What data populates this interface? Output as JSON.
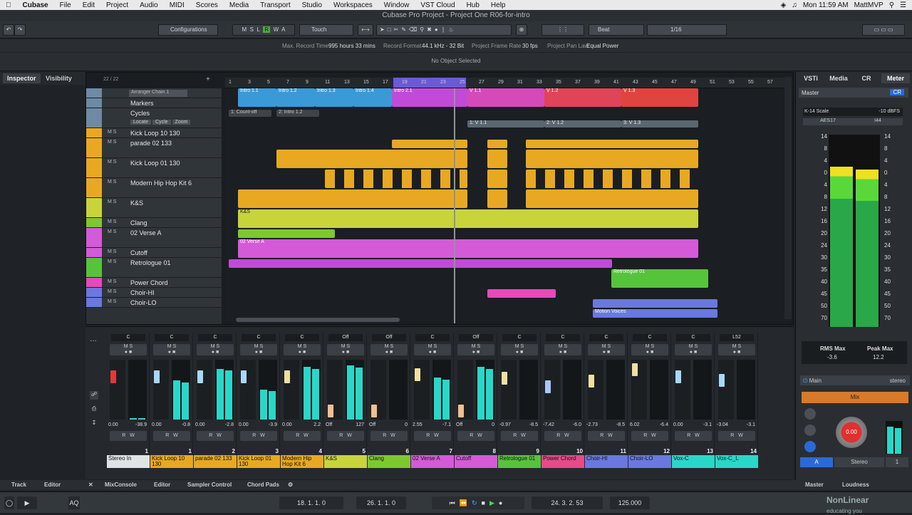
{
  "menubar": {
    "items": [
      "Cubase",
      "File",
      "Edit",
      "Project",
      "Audio",
      "MIDI",
      "Scores",
      "Media",
      "Transport",
      "Studio",
      "Workspaces",
      "Window",
      "VST Cloud",
      "Hub",
      "Help"
    ],
    "clock": "Mon 11:59 AM",
    "user": "MattMVP"
  },
  "window_title": "Cubase Pro Project - Project One R06-for-intro",
  "toolbar": {
    "configurations": "Configurations",
    "automation_mode": "Touch",
    "snap_type": "Beat",
    "quantize": "1/16",
    "msrwa": [
      "M",
      "S",
      "L",
      "R",
      "W",
      "A"
    ]
  },
  "infobar": {
    "max_record_time_label": "Max. Record Time",
    "max_record_time": "995 hours 33 mins",
    "record_format_label": "Record Format",
    "record_format": "44.1 kHz - 32 Bit",
    "frame_rate_label": "Project Frame Rate",
    "frame_rate": "30 fps",
    "pan_law_label": "Project Pan Law",
    "pan_law": "Equal Power"
  },
  "selection_status": "No Object Selected",
  "left_tabs": [
    "Inspector",
    "Visibility"
  ],
  "track_count": "22 / 22",
  "arranger_chain": "Arranger Chain 1",
  "cycle_buttons": [
    "Locate",
    "Cycle",
    "Zoom"
  ],
  "tracks": [
    {
      "name": "Markers",
      "color": "#6e8aa4"
    },
    {
      "name": "Cycles",
      "color": "#6e8aa4"
    },
    {
      "name": "Kick Loop 10 130",
      "color": "#e9a822"
    },
    {
      "name": "parade 02 133",
      "color": "#e9a822"
    },
    {
      "name": "Kick Loop 01 130",
      "color": "#e9a822"
    },
    {
      "name": "Modern Hip Hop Kit 6",
      "color": "#e9a822"
    },
    {
      "name": "K&S",
      "color": "#c8d43a"
    },
    {
      "name": "Clang",
      "color": "#7ec82f"
    },
    {
      "name": "02 Verse A",
      "color": "#d45ad8"
    },
    {
      "name": "Cutoff",
      "color": "#d45ad8"
    },
    {
      "name": "Retrologue 01",
      "color": "#56c43a"
    },
    {
      "name": "Power Chord",
      "color": "#e64ab8"
    },
    {
      "name": "Choir-HI",
      "color": "#6a78e0"
    },
    {
      "name": "Choir-LO",
      "color": "#6a78e0"
    }
  ],
  "ruler": [
    "1",
    "3",
    "5",
    "7",
    "9",
    "11",
    "13",
    "15",
    "17",
    "19",
    "21",
    "23",
    "25",
    "27",
    "29",
    "31",
    "33",
    "35",
    "37",
    "39",
    "41",
    "43",
    "45",
    "47",
    "49",
    "51",
    "53",
    "55",
    "57"
  ],
  "arranger_parts": [
    {
      "label": "Intro 1.1",
      "color": "#3a9ad8"
    },
    {
      "label": "Intro 1.2",
      "color": "#3a9ad8"
    },
    {
      "label": "Intro 1.3",
      "color": "#3a9ad8"
    },
    {
      "label": "Intro 1.4",
      "color": "#3a9ad8"
    },
    {
      "label": "Intro 2.1",
      "color": "#c24ad8"
    },
    {
      "label": "V 1.1",
      "color": "#d44ab8"
    },
    {
      "label": "V 1.2",
      "color": "#e04458"
    },
    {
      "label": "V 1.3",
      "color": "#e04440"
    }
  ],
  "markers": [
    "1: Count-off",
    "2: Intro 1.2"
  ],
  "cycle_markers": [
    "1: V 1.1",
    "2: V 1.2",
    "3: V 1.3"
  ],
  "clip_labels": {
    "ks": "K&S",
    "verse": "02 Verse A",
    "retro": "Retrologue 01",
    "motion": "Motion Voices"
  },
  "right_tabs": [
    "VSTi",
    "Media",
    "CR",
    "Meter"
  ],
  "meter": {
    "master_label": "Master",
    "scale": "K-14 Scale",
    "dbfs": "-10 dBFS",
    "aes": "AES17",
    "i44": "I44",
    "scale_left": [
      "14",
      "8",
      "4",
      "0",
      "4",
      "8",
      "12",
      "16",
      "20",
      "24",
      "30",
      "35",
      "40",
      "45",
      "50",
      "70"
    ],
    "scale_right": [
      "14",
      "8",
      "4",
      "0",
      "4",
      "8",
      "12",
      "16",
      "20",
      "24",
      "30",
      "35",
      "40",
      "45",
      "50",
      "70"
    ],
    "rms_label": "RMS Max",
    "rms_value": "-3.6",
    "peak_label": "Peak Max",
    "peak_value": "12.2",
    "main_label": "Main",
    "stereo_label": "stereo",
    "mix_label": "Mix",
    "knob_value": "0.00",
    "a_label": "A",
    "stereo_btn": "Stereo",
    "one_btn": "1"
  },
  "mixer": {
    "strips": [
      {
        "num": "1",
        "name": "Stereo In",
        "color": "#dfe3e6",
        "pan": "C",
        "val1": "0.00",
        "val2": "-38.9",
        "fader": 0.78,
        "meter": 0.02,
        "knob": "#e03a3a"
      },
      {
        "num": "1",
        "name": "Kick Loop 10 130",
        "color": "#e9a822",
        "pan": "C",
        "val1": "0.00",
        "val2": "-0.8",
        "fader": 0.78,
        "meter": 0.65,
        "knob": "#a8d8f8"
      },
      {
        "num": "2",
        "name": "parade 02 133",
        "color": "#e9a822",
        "pan": "C",
        "val1": "0.00",
        "val2": "-2.8",
        "fader": 0.78,
        "meter": 0.85,
        "knob": "#a8d8f8"
      },
      {
        "num": "3",
        "name": "Kick Loop 01 130",
        "color": "#e9a822",
        "pan": "C",
        "val1": "0.00",
        "val2": "-3.9",
        "fader": 0.78,
        "meter": 0.5,
        "knob": "#a8d8f8"
      },
      {
        "num": "4",
        "name": "Modern Hip Hop Kit 6",
        "color": "#e9a822",
        "pan": "C",
        "val1": "0.00",
        "val2": "2.2",
        "fader": 0.78,
        "meter": 0.88,
        "knob": "#f0e0a0"
      },
      {
        "num": "5",
        "name": "K&S",
        "color": "#c8d43a",
        "pan": "Off",
        "val1": "Off",
        "val2": "127",
        "fader": 0.05,
        "meter": 0.9,
        "knob": "#f0c090"
      },
      {
        "num": "6",
        "name": "Clang",
        "color": "#7ec82f",
        "pan": "Off",
        "val1": "Off",
        "val2": "0",
        "fader": 0.05,
        "meter": 0.0,
        "knob": "#f0c090"
      },
      {
        "num": "7",
        "name": "02 Verse A",
        "color": "#d45ad8",
        "pan": "C",
        "val1": "2.55",
        "val2": "-7.1",
        "fader": 0.82,
        "meter": 0.7,
        "knob": "#f0e0a0"
      },
      {
        "num": "8",
        "name": "Cutoff",
        "color": "#d45ad8",
        "pan": "Off",
        "val1": "Off",
        "val2": "0",
        "fader": 0.05,
        "meter": 0.88,
        "knob": "#f0c090"
      },
      {
        "num": "9",
        "name": "Retrologue 01",
        "color": "#56c43a",
        "pan": "C",
        "val1": "-0.97",
        "val2": "-8.5",
        "fader": 0.74,
        "meter": 0.0,
        "knob": "#f0e0a0"
      },
      {
        "num": "10",
        "name": "Power Chord",
        "color": "#e64a88",
        "pan": "C",
        "val1": "-7.42",
        "val2": "-6.0",
        "fader": 0.56,
        "meter": 0.0,
        "knob": "#a8c8f8"
      },
      {
        "num": "11",
        "name": "Choir-HI",
        "color": "#6a78e0",
        "pan": "C",
        "val1": "-2.73",
        "val2": "-8.5",
        "fader": 0.68,
        "meter": 0.0,
        "knob": "#f0e0a0"
      },
      {
        "num": "12",
        "name": "Choir-LO",
        "color": "#6a78e0",
        "pan": "C",
        "val1": "6.02",
        "val2": "-6.4",
        "fader": 0.92,
        "meter": 0.0,
        "knob": "#f0e0a0"
      },
      {
        "num": "13",
        "name": "Vox-C",
        "color": "#29d7c9",
        "pan": "C",
        "val1": "0.00",
        "val2": "-3.1",
        "fader": 0.78,
        "meter": 0.0,
        "knob": "#a8d8f8"
      },
      {
        "num": "14",
        "name": "Vox-C_L",
        "color": "#29d7c9",
        "pan": "L52",
        "val1": "-3.04",
        "val2": "-3.1",
        "fader": 0.7,
        "meter": 0.0,
        "knob": "#a8d8f8"
      }
    ]
  },
  "bottom_tabs": [
    "Track",
    "Editor",
    "MixConsole",
    "Editor",
    "Sampler Control",
    "Chord Pads"
  ],
  "right_bottom_tabs": [
    "Master",
    "Loudness"
  ],
  "transport": {
    "left_locator": "18. 1. 1.    0",
    "right_locator": "26. 1. 1.    0",
    "position": "24. 3. 2. 53",
    "tempo": "125.000"
  },
  "watermark": {
    "line1": "NonLinear",
    "line2": "educating you"
  }
}
